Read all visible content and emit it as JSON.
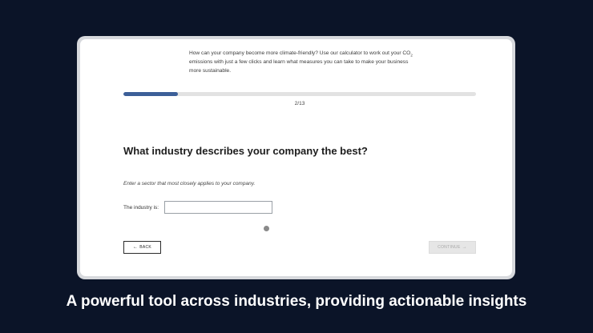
{
  "intro": {
    "text_before": "How can your company become more climate-friendly? Use our calculator to work out your CO",
    "subscript": "2",
    "text_after": " emissions with just a few clicks and learn what measures you can take to make your business more sustainable."
  },
  "progress": {
    "fraction": 0.154,
    "step_label": "2/13",
    "fill_color": "#3c5f98"
  },
  "question": {
    "title": "What industry describes your company the best?",
    "hint": "Enter a sector that most closely applies to your company."
  },
  "industry_field": {
    "label": "The industry is:",
    "value": ""
  },
  "buttons": {
    "back_icon": "arrow-left-icon",
    "back_label": "BACK",
    "continue_label": "CONTINUE",
    "continue_icon": "arrow-right-icon"
  },
  "caption": "A powerful tool across industries, providing actionable insights",
  "colors": {
    "background": "#0b1428",
    "frame": "#d7d9dd"
  }
}
